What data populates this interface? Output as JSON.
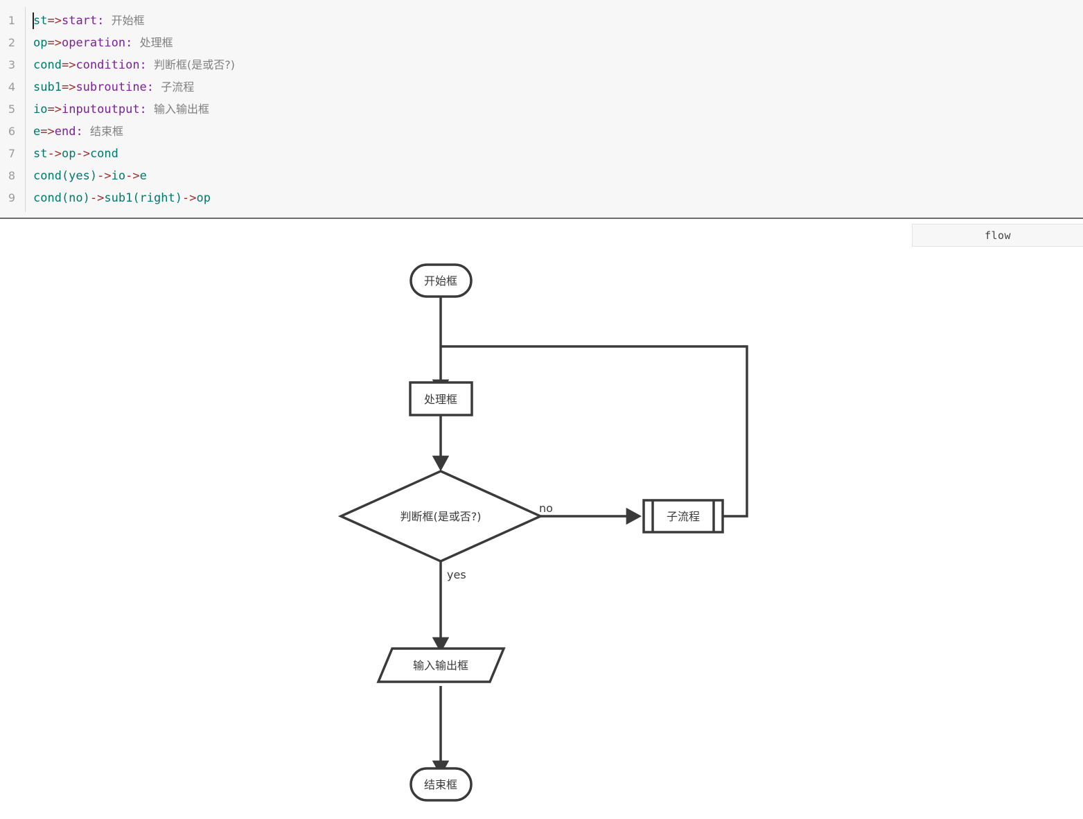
{
  "editor": {
    "name": "flowchart-source-editor",
    "caret_line": 1,
    "lines": [
      {
        "number": "1",
        "id": "st",
        "arrow": "=>",
        "type": "start:",
        "label": "开始框",
        "raw": "st=>start: 开始框"
      },
      {
        "number": "2",
        "id": "op",
        "arrow": "=>",
        "type": "operation:",
        "label": "处理框",
        "raw": "op=>operation: 处理框"
      },
      {
        "number": "3",
        "id": "cond",
        "arrow": "=>",
        "type": "condition:",
        "label": "判断框(是或否?)",
        "raw": "cond=>condition: 判断框(是或否?)"
      },
      {
        "number": "4",
        "id": "sub1",
        "arrow": "=>",
        "type": "subroutine:",
        "label": "子流程",
        "raw": "sub1=>subroutine: 子流程"
      },
      {
        "number": "5",
        "id": "io",
        "arrow": "=>",
        "type": "inputoutput:",
        "label": "输入输出框",
        "raw": "io=>inputoutput: 输入输出框"
      },
      {
        "number": "6",
        "id": "e",
        "arrow": "=>",
        "type": "end:",
        "label": "结束框",
        "raw": "e=>end: 结束框"
      },
      {
        "number": "7",
        "segments": [
          {
            "t": "st",
            "k": "id"
          },
          {
            "t": "->",
            "k": "arr"
          },
          {
            "t": "op",
            "k": "id"
          },
          {
            "t": "->",
            "k": "arr"
          },
          {
            "t": "cond",
            "k": "id"
          }
        ],
        "raw": "st->op->cond"
      },
      {
        "number": "8",
        "segments": [
          {
            "t": "cond(yes)",
            "k": "id"
          },
          {
            "t": "->",
            "k": "arr"
          },
          {
            "t": "io",
            "k": "id"
          },
          {
            "t": "->",
            "k": "arr"
          },
          {
            "t": "e",
            "k": "id"
          }
        ],
        "raw": "cond(yes)->io->e"
      },
      {
        "number": "9",
        "segments": [
          {
            "t": "cond(no)",
            "k": "id"
          },
          {
            "t": "->",
            "k": "arr"
          },
          {
            "t": "sub1(right)",
            "k": "id"
          },
          {
            "t": "->",
            "k": "arr"
          },
          {
            "t": "op",
            "k": "id"
          }
        ],
        "raw": "cond(no)->sub1(right)->op"
      }
    ]
  },
  "preview": {
    "tab_label": "flow"
  },
  "flowchart": {
    "stroke_color": "#3a3a3a",
    "fill_color": "#ffffff",
    "text_color": "#3a3a3a",
    "nodes": {
      "start": {
        "key": "st",
        "shape": "stadium",
        "text": "开始框"
      },
      "operation": {
        "key": "op",
        "shape": "rectangle",
        "text": "处理框"
      },
      "condition": {
        "key": "cond",
        "shape": "diamond",
        "text": "判断框(是或否?)"
      },
      "subroutine": {
        "key": "sub1",
        "shape": "subroutine",
        "text": "子流程"
      },
      "inputoutput": {
        "key": "io",
        "shape": "parallelogram",
        "text": "输入输出框"
      },
      "end": {
        "key": "e",
        "shape": "stadium",
        "text": "结束框"
      }
    },
    "edge_labels": {
      "condition_no": "no",
      "condition_yes": "yes"
    }
  }
}
